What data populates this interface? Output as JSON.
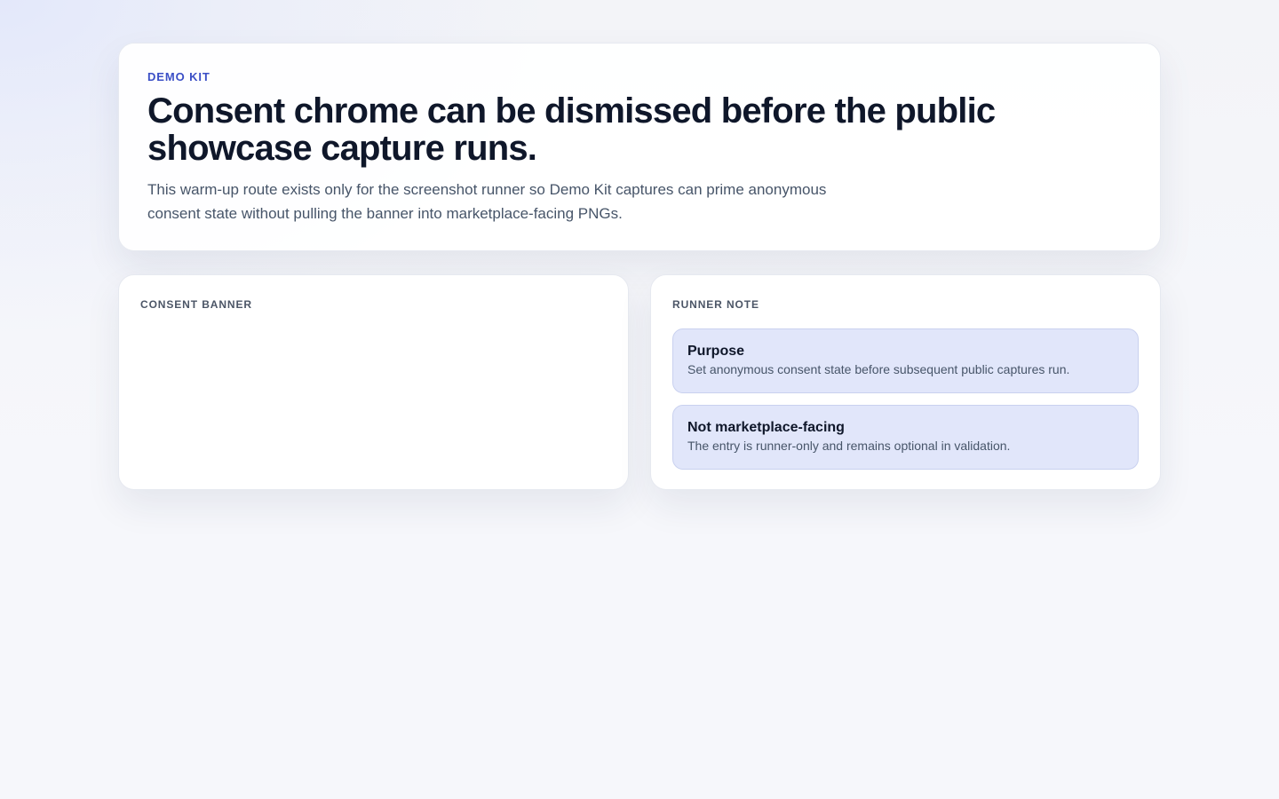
{
  "hero": {
    "eyebrow": "DEMO KIT",
    "title": "Consent chrome can be dismissed before the public showcase capture runs.",
    "description": "This warm-up route exists only for the screenshot runner so Demo Kit captures can prime anonymous consent state without pulling the banner into marketplace-facing PNGs."
  },
  "consent_card": {
    "label": "CONSENT BANNER"
  },
  "runner_card": {
    "label": "RUNNER NOTE",
    "notes": [
      {
        "title": "Purpose",
        "body": "Set anonymous consent state before subsequent public captures run."
      },
      {
        "title": "Not marketplace-facing",
        "body": "The entry is runner-only and remains optional in validation."
      }
    ]
  },
  "colors": {
    "accent": "#3b4fc6",
    "note_background": "#e1e6fa",
    "heading": "#0f172a",
    "muted_text": "#475569"
  }
}
